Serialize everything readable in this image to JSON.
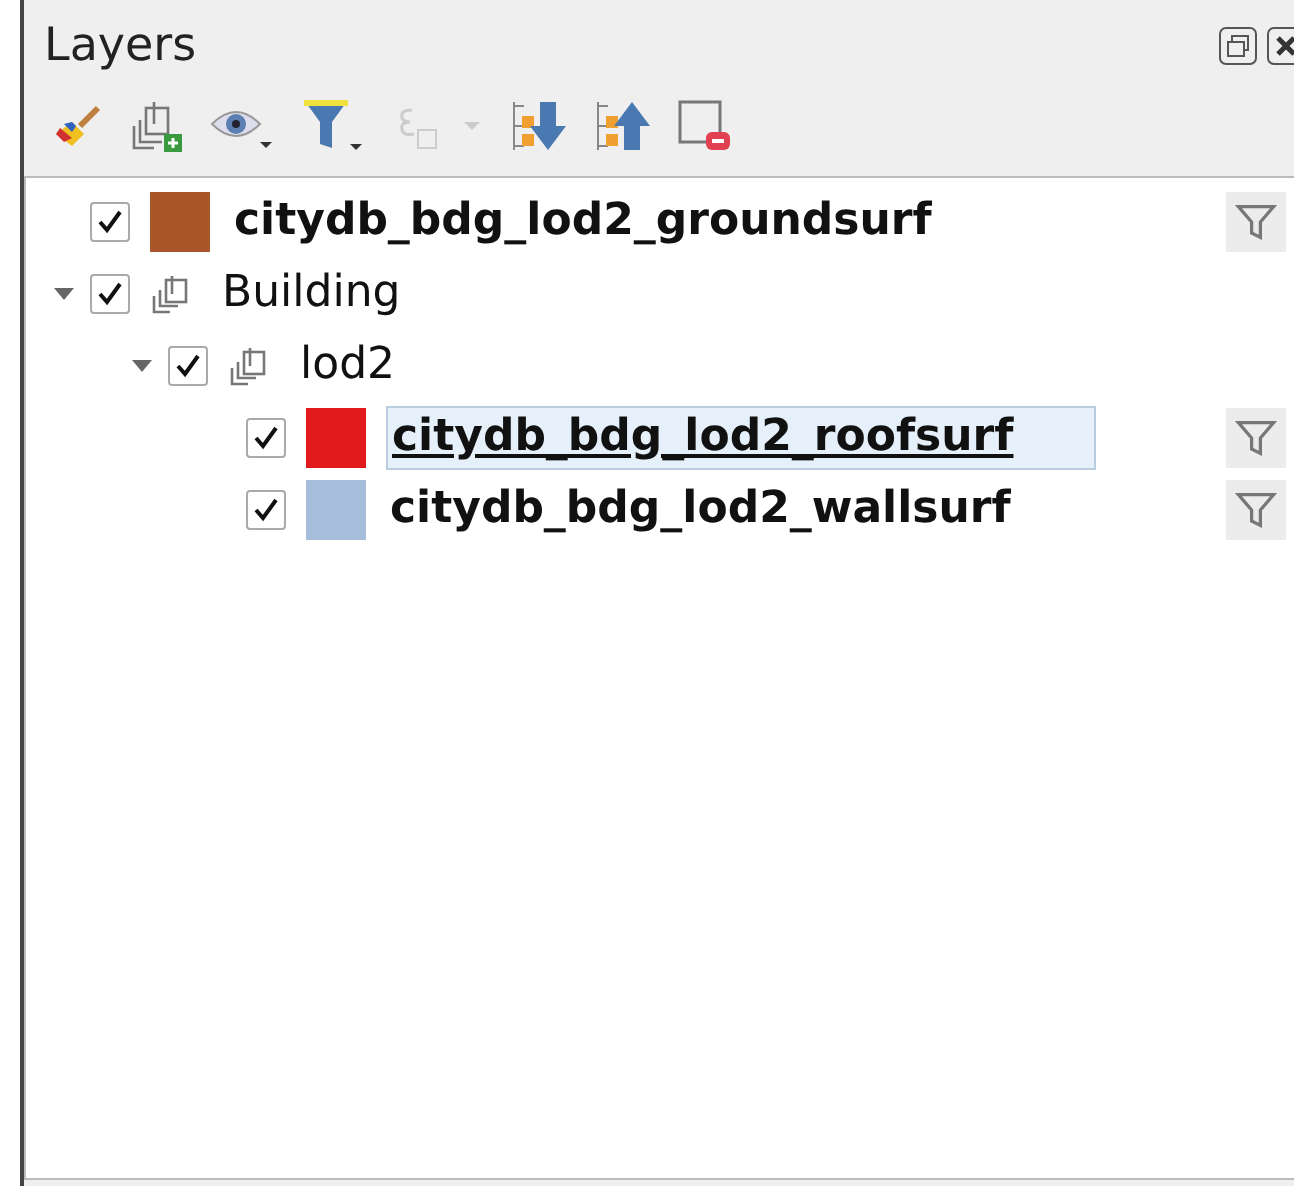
{
  "panel": {
    "title": "Layers"
  },
  "tree": [
    {
      "kind": "layer",
      "name": "citydb_bdg_lod2_groundsurf",
      "checked": true,
      "selected": false,
      "color": "#a9572a"
    },
    {
      "kind": "group",
      "name": "Building",
      "checked": true,
      "expanded": true,
      "selected": false,
      "children": [
        {
          "kind": "group",
          "name": "lod2",
          "checked": true,
          "expanded": true,
          "selected": false,
          "children": [
            {
              "kind": "layer",
              "name": "citydb_bdg_lod2_roofsurf",
              "checked": true,
              "selected": true,
              "color": "#e31a1c"
            },
            {
              "kind": "layer",
              "name": "citydb_bdg_lod2_wallsurf",
              "checked": true,
              "selected": false,
              "color": "#a6bddb"
            }
          ]
        }
      ]
    }
  ]
}
